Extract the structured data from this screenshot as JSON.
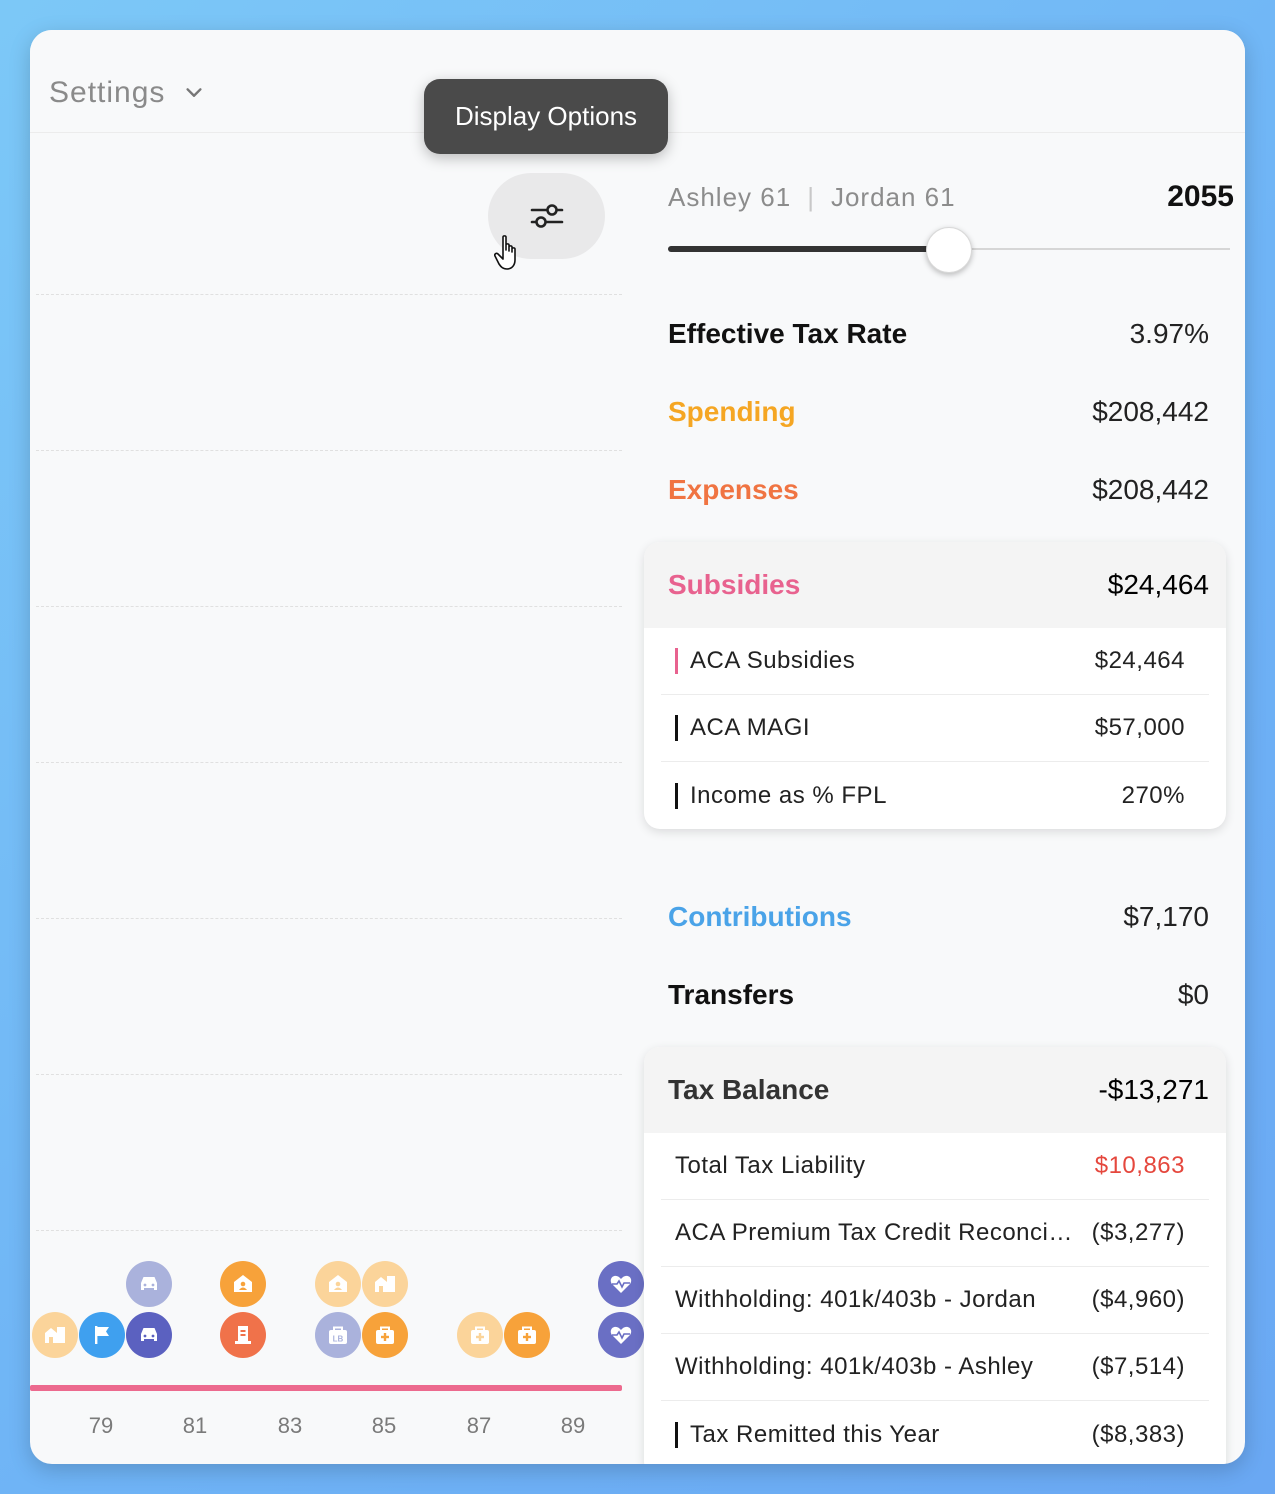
{
  "header": {
    "settings_label": "Settings",
    "tooltip": "Display Options"
  },
  "chart": {
    "x_ticks": [
      "79",
      "81",
      "83",
      "85",
      "87",
      "89"
    ]
  },
  "panel": {
    "person1": "Ashley 61",
    "person2": "Jordan 61",
    "year": "2055",
    "slider_value_pct": 50,
    "effective_tax_rate": {
      "label": "Effective Tax Rate",
      "value": "3.97%"
    },
    "spending": {
      "label": "Spending",
      "value": "$208,442",
      "color": "#f5a623"
    },
    "expenses": {
      "label": "Expenses",
      "value": "$208,442",
      "color": "#f07442"
    },
    "subsidies": {
      "label": "Subsidies",
      "value": "$24,464",
      "color": "#e8628f",
      "items": [
        {
          "label": "ACA Subsidies",
          "value": "$24,464",
          "bar": "#e8628f"
        },
        {
          "label": "ACA MAGI",
          "value": "$57,000",
          "bar": "#111111"
        },
        {
          "label": "Income as % FPL",
          "value": "270%",
          "bar": "#111111"
        }
      ]
    },
    "contributions": {
      "label": "Contributions",
      "value": "$7,170",
      "color": "#4aa3e8"
    },
    "transfers": {
      "label": "Transfers",
      "value": "$0"
    },
    "tax_balance": {
      "label": "Tax Balance",
      "value": "-$13,271",
      "items": [
        {
          "label": "Total Tax Liability",
          "value": "$10,863",
          "value_color": "#e5473d"
        },
        {
          "label": "ACA Premium Tax Credit Reconciliation",
          "value": "($3,277)"
        },
        {
          "label": "Withholding: 401k/403b - Jordan",
          "value": "($4,960)"
        },
        {
          "label": "Withholding: 401k/403b - Ashley",
          "value": "($7,514)"
        },
        {
          "label": "Tax Remitted this Year",
          "value": "($8,383)",
          "bar": "#111111"
        }
      ]
    }
  }
}
